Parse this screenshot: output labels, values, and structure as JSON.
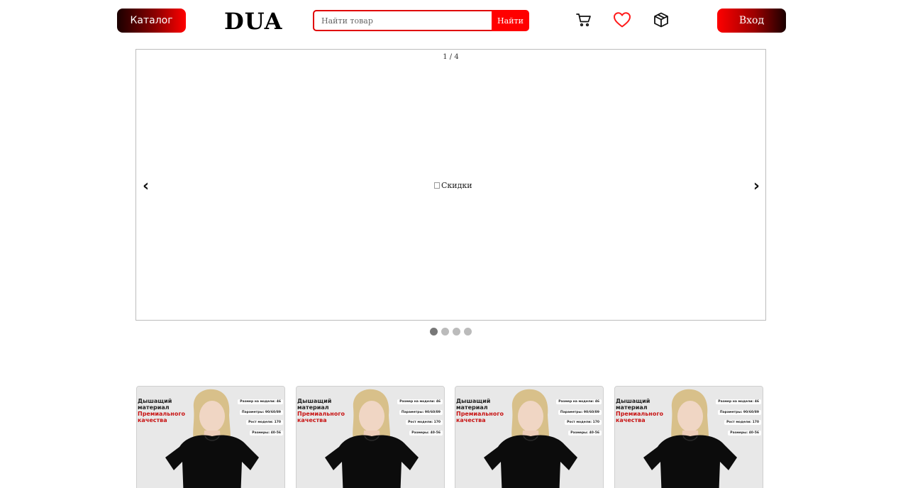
{
  "header": {
    "catalog_label": "Каталог",
    "logo": "DUA",
    "search_placeholder": "Найти товар",
    "search_button": "Найти",
    "login_label": "Вход",
    "icons": [
      "cart-icon",
      "heart-icon",
      "package-icon"
    ],
    "accent_color": "#ff0000"
  },
  "slider": {
    "counter": "1 / 4",
    "image_alt": "Скидки",
    "prev_label": "‹",
    "next_label": "›",
    "total_slides": 4,
    "active_index": 0
  },
  "products": [
    {
      "text_line1": "Дышащий",
      "text_line2": "материал",
      "text_line3": "Премиального",
      "text_line4": "качества",
      "tags": [
        "Размер на модели: 46",
        "Параметры: 90/60/89",
        "Рост модели: 170",
        "Размеры: 40-56"
      ]
    },
    {
      "text_line1": "Дышащий",
      "text_line2": "материал",
      "text_line3": "Премиального",
      "text_line4": "качества",
      "tags": [
        "Размер на модели: 46",
        "Параметры: 90/60/89",
        "Рост модели: 170",
        "Размеры: 40-56"
      ]
    },
    {
      "text_line1": "Дышащий",
      "text_line2": "материал",
      "text_line3": "Премиального",
      "text_line4": "качества",
      "tags": [
        "Размер на модели: 46",
        "Параметры: 90/60/89",
        "Рост модели: 170",
        "Размеры: 40-56"
      ]
    },
    {
      "text_line1": "Дышащий",
      "text_line2": "материал",
      "text_line3": "Премиального",
      "text_line4": "качества",
      "tags": [
        "Размер на модели: 46",
        "Параметры: 90/60/89",
        "Рост модели: 170",
        "Размеры: 40-56"
      ]
    }
  ]
}
